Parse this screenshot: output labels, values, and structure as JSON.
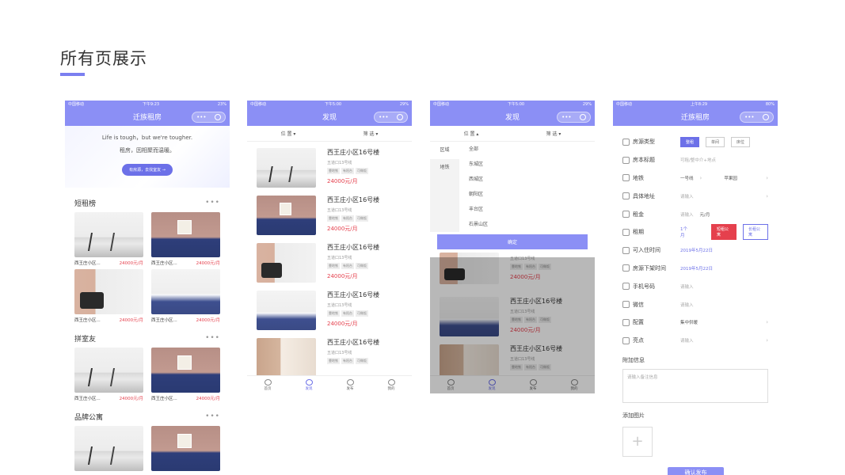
{
  "page_title": "所有页展示",
  "status": {
    "carrier": "中国移动",
    "time1": "下午9:23",
    "batt1": "23%",
    "time2": "下午5:00",
    "batt2": "29%",
    "time4": "上午8:29",
    "batt4": "80%"
  },
  "capsule": {
    "dots": "•••"
  },
  "phone1": {
    "nav_title": "迁族租房",
    "hero_line1": "Life is tough，but we're tougher.",
    "hero_line2": "租房，因相聚而温暖。",
    "hero_button": "有房源，去找室友 →",
    "sections": [
      {
        "title": "短租榜",
        "more": "•••"
      },
      {
        "title": "拼室友",
        "more": "•••"
      },
      {
        "title": "品牌公寓",
        "more": "•••"
      }
    ],
    "card_name": "西王庄小区...",
    "card_price": "24000元/月"
  },
  "phone2": {
    "nav_title": "发现",
    "filter_location": "位 置 ▾",
    "filter_screen": "筛 选 ▾",
    "item_name": "西王庄小区16号楼",
    "item_sub": "五道口13号线",
    "item_tags": [
      "靠地铁",
      "有阳台",
      "可做饭"
    ],
    "item_price": "24000元/月",
    "tabs": [
      "首页",
      "发现",
      "发布",
      "我的"
    ]
  },
  "phone3": {
    "nav_title": "发现",
    "filter_location": "位 置 ▴",
    "filter_screen": "筛 选 ▾",
    "left_options": [
      "区域",
      "地铁"
    ],
    "right_options": [
      "全部",
      "东城区",
      "西城区",
      "朝阳区",
      "丰台区",
      "石景山区"
    ],
    "confirm": "确定"
  },
  "phone4": {
    "nav_title": "迁族租房",
    "type_label": "房源类型",
    "type_options": [
      "整租",
      "单间",
      "床位"
    ],
    "title_label": "房本标题",
    "title_placeholder": "可租/整中介+地点",
    "subway_label": "地铁",
    "subway_line": "一号线",
    "subway_station": "苹果园",
    "address_label": "具体地址",
    "address_placeholder": "请输入",
    "rent_label": "租金",
    "rent_placeholder": "请输入",
    "rent_unit": "元/月",
    "term_label": "租期",
    "term_value": "1个月",
    "term_short": "短租公寓",
    "term_long": "长租公寓",
    "checkin_label": "可入住时间",
    "checkin_value": "2019年5月22日",
    "offline_label": "房源下架时间",
    "offline_value": "2019年5月22日",
    "phone_label": "手机号码",
    "phone_placeholder": "请输入",
    "wechat_label": "微信",
    "wechat_placeholder": "请输入",
    "config_label": "配置",
    "config_value": "集中供暖",
    "highlight_label": "亮点",
    "highlight_placeholder": "请输入",
    "extra_label": "附加信息",
    "extra_placeholder": "请输入备注信息",
    "photo_label": "添加图片",
    "submit": "确认发布"
  }
}
